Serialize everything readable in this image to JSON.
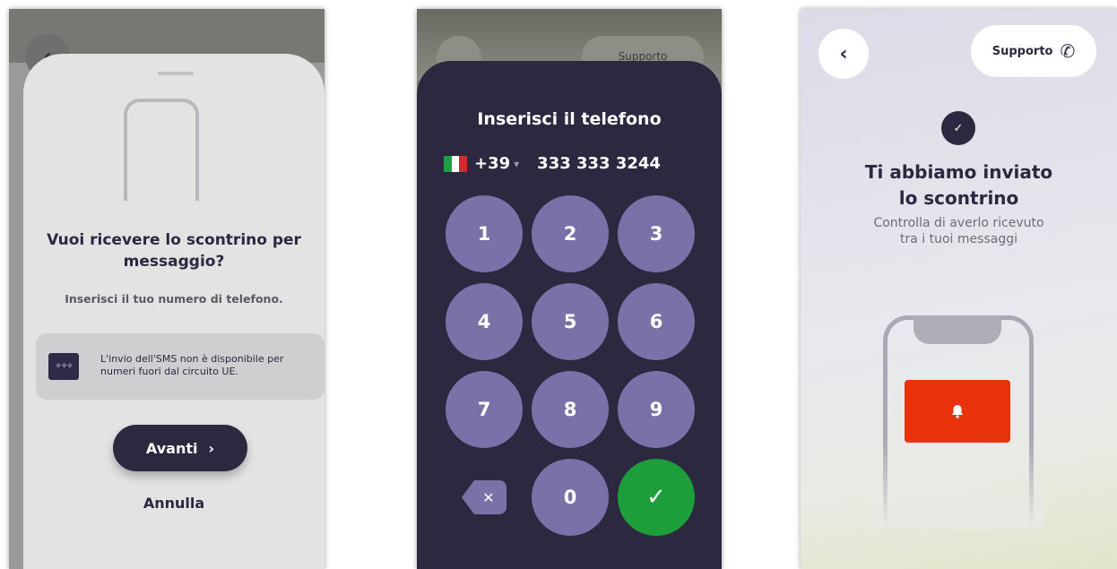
{
  "screen1": {
    "back_icon": "‹",
    "title": "Vuoi ricevere lo scontrino per messaggio?",
    "subtitle": "Inserisci il tuo numero di telefono.",
    "notice": "L'invio dell'SMS non è disponibile per numeri fuori dal circuito UE.",
    "eu_icon": "EU-flag-icon",
    "next_label": "Avanti",
    "next_icon": "›",
    "cancel_label": "Annulla"
  },
  "screen2": {
    "title": "Inserisci il telefono",
    "country_flag": "italy-flag-icon",
    "country_code": "+39",
    "caret": "▾",
    "phone_number": "333 333 3244",
    "keys": [
      "1",
      "2",
      "3",
      "4",
      "5",
      "6",
      "7",
      "8",
      "9"
    ],
    "zero": "0",
    "delete_icon": "✕",
    "confirm_icon": "✓",
    "ghost_support": "Supporto"
  },
  "screen3": {
    "back_icon": "‹",
    "support_label": "Supporto",
    "phone_icon": "✆",
    "check_icon": "✓",
    "title_line1": "Ti abbiamo inviato",
    "title_line2": "lo scontrino",
    "subtitle_line1": "Controlla di averlo ricevuto",
    "subtitle_line2": "tra i tuoi messaggi",
    "bell_icon": "🔔"
  },
  "colors": {
    "primary": "#2b2840",
    "keypad_key": "#7a71a8",
    "confirm": "#1e9e3a",
    "alert": "#e8320b",
    "italy_green": "#1f9e48",
    "italy_white": "#ffffff",
    "italy_red": "#d8262e"
  }
}
